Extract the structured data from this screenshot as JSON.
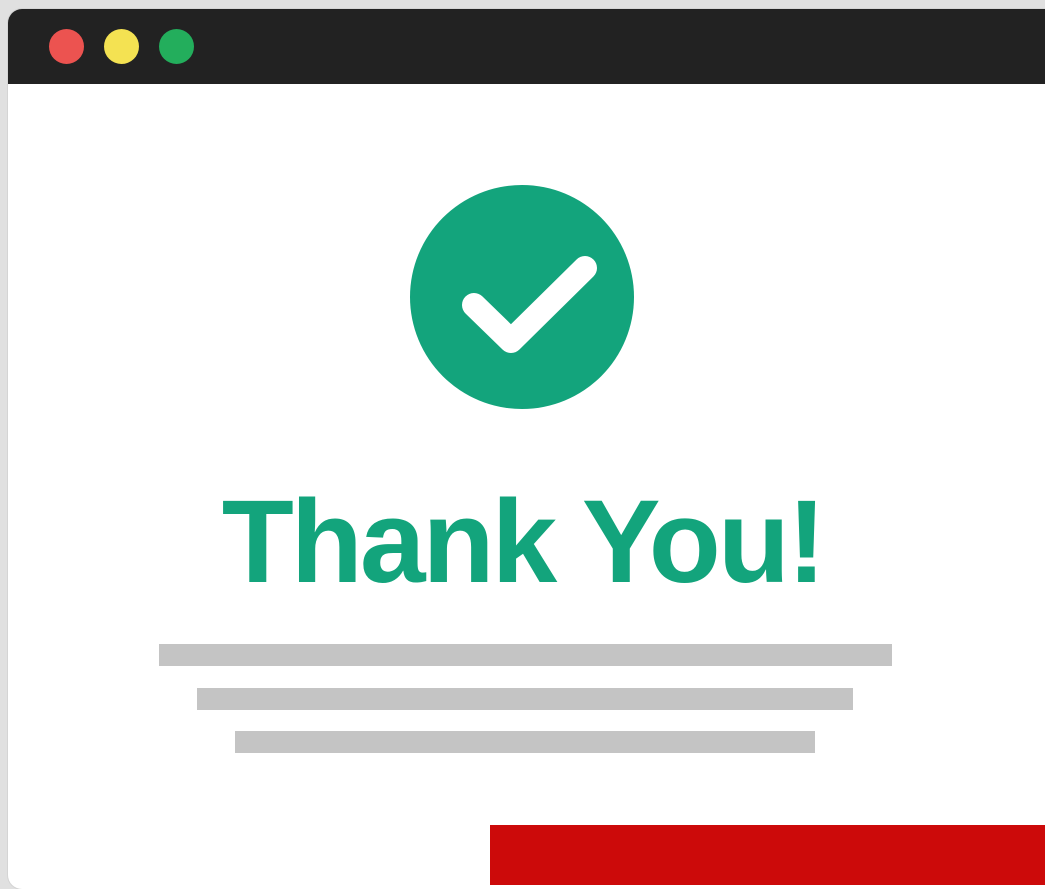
{
  "window": {
    "controls": [
      {
        "name": "close-button",
        "color": "#ec5350"
      },
      {
        "name": "minimize-button",
        "color": "#f4e252"
      },
      {
        "name": "maximize-button",
        "color": "#23ae5c"
      }
    ]
  },
  "colors": {
    "accent": "#13a47c",
    "placeholder": "#c4c4c4",
    "cta": "#cc0a0a"
  },
  "main": {
    "icon": "checkmark-circle-icon",
    "title": "Thank You!"
  }
}
